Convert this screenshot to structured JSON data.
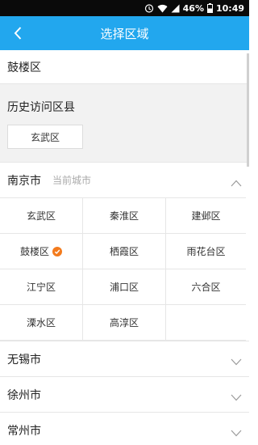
{
  "status_bar": {
    "battery": "46%",
    "time": "10:49",
    "icons": [
      "alarm-icon",
      "wifi-icon",
      "signal-icon",
      "battery-icon"
    ]
  },
  "header": {
    "title": "选择区域",
    "back_icon": "back-arrow-icon"
  },
  "current_area": "鼓楼区",
  "history": {
    "title": "历史访问区县",
    "items": [
      "玄武区"
    ]
  },
  "provinces": [
    {
      "name": "南京市",
      "hint": "当前城市",
      "expanded": true,
      "districts": [
        {
          "name": "玄武区",
          "selected": false
        },
        {
          "name": "秦淮区",
          "selected": false
        },
        {
          "name": "建邺区",
          "selected": false
        },
        {
          "name": "鼓楼区",
          "selected": true
        },
        {
          "name": "栖霞区",
          "selected": false
        },
        {
          "name": "雨花台区",
          "selected": false
        },
        {
          "name": "江宁区",
          "selected": false
        },
        {
          "name": "浦口区",
          "selected": false
        },
        {
          "name": "六合区",
          "selected": false
        },
        {
          "name": "溧水区",
          "selected": false
        },
        {
          "name": "高淳区",
          "selected": false
        },
        {
          "name": "",
          "selected": false
        }
      ]
    },
    {
      "name": "无锡市",
      "expanded": false
    },
    {
      "name": "徐州市",
      "expanded": false
    },
    {
      "name": "常州市",
      "expanded": false
    }
  ],
  "colors": {
    "accent": "#22a7ee",
    "check": "#f37b1d",
    "history_bg": "#f2f2f2"
  }
}
